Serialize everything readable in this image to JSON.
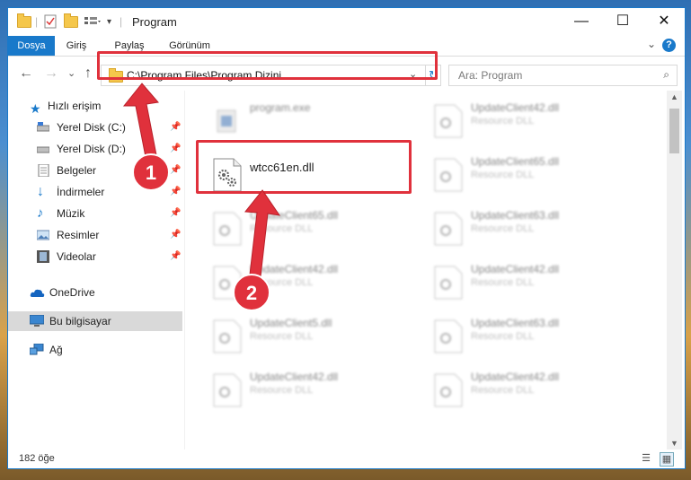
{
  "window": {
    "title": "Program",
    "minimize_glyph": "—",
    "maximize_glyph": "☐",
    "close_glyph": "✕"
  },
  "ribbon": {
    "tabs": [
      {
        "label": "Dosya",
        "active": true
      },
      {
        "label": "Giriş",
        "active": false
      },
      {
        "label": "Paylaş",
        "active": false
      },
      {
        "label": "Görünüm",
        "active": false
      }
    ],
    "help_glyph": "?"
  },
  "navigation": {
    "back_glyph": "←",
    "forward_glyph": "→",
    "recent_glyph": "⌄",
    "up_glyph": "↑",
    "address_path": "C:\\Program Files\\Program Dizini",
    "search_placeholder": "Ara: Program"
  },
  "sidebar": {
    "items": [
      {
        "label": "Hızlı erişim",
        "icon": "star-icon",
        "pinned": false,
        "selected": false
      },
      {
        "label": "Yerel Disk (C:)",
        "icon": "drive-icon",
        "pinned": true,
        "selected": false
      },
      {
        "label": "Yerel Disk (D:)",
        "icon": "drive-icon",
        "pinned": true,
        "selected": false
      },
      {
        "label": "Belgeler",
        "icon": "documents-icon",
        "pinned": true,
        "selected": false
      },
      {
        "label": "İndirmeler",
        "icon": "download-icon",
        "pinned": true,
        "selected": false
      },
      {
        "label": "Müzik",
        "icon": "music-icon",
        "pinned": true,
        "selected": false
      },
      {
        "label": "Resimler",
        "icon": "pictures-icon",
        "pinned": true,
        "selected": false
      },
      {
        "label": "Videolar",
        "icon": "videos-icon",
        "pinned": true,
        "selected": false
      },
      {
        "label": "OneDrive",
        "icon": "cloud-icon",
        "pinned": false,
        "selected": false
      },
      {
        "label": "Bu bilgisayar",
        "icon": "computer-icon",
        "pinned": false,
        "selected": true
      },
      {
        "label": "Ağ",
        "icon": "network-icon",
        "pinned": false,
        "selected": false
      }
    ]
  },
  "files": [
    {
      "name": "program.exe",
      "type": "",
      "icon": "exe-icon",
      "blurred": true
    },
    {
      "name": "UpdateClient42.dll",
      "type": "Resource DLL",
      "icon": "dll-gear-icon",
      "blurred": true
    },
    {
      "name": "wtcc61en.dll",
      "type": "",
      "icon": "dll-gear-icon",
      "blurred": false
    },
    {
      "name": "UpdateClient65.dll",
      "type": "Resource DLL",
      "icon": "dll-gear-icon",
      "blurred": true
    },
    {
      "name": "UpdateClient65.dll",
      "type": "Resource DLL",
      "icon": "dll-gear-icon",
      "blurred": true
    },
    {
      "name": "UpdateClient63.dll",
      "type": "Resource DLL",
      "icon": "dll-gear-icon",
      "blurred": true
    },
    {
      "name": "UpdateClient42.dll",
      "type": "Resource DLL",
      "icon": "dll-gear-icon",
      "blurred": true
    },
    {
      "name": "UpdateClient42.dll",
      "type": "Resource DLL",
      "icon": "dll-gear-icon",
      "blurred": true
    },
    {
      "name": "UpdateClient5.dll",
      "type": "Resource DLL",
      "icon": "dll-gear-icon",
      "blurred": true
    },
    {
      "name": "UpdateClient63.dll",
      "type": "Resource DLL",
      "icon": "dll-gear-icon",
      "blurred": true
    },
    {
      "name": "UpdateClient42.dll",
      "type": "Resource DLL",
      "icon": "dll-gear-icon",
      "blurred": true
    },
    {
      "name": "UpdateClient42.dll",
      "type": "Resource DLL",
      "icon": "dll-gear-icon",
      "blurred": true
    }
  ],
  "status": {
    "item_count": "182 öğe"
  },
  "annotations": {
    "step1": "1",
    "step2": "2",
    "color": "#e0313c"
  }
}
